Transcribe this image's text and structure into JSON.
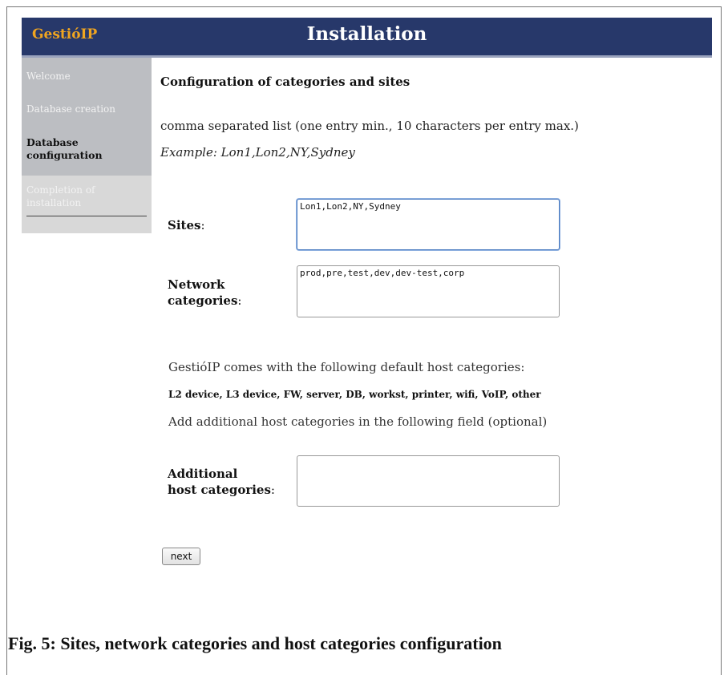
{
  "header": {
    "logo": "GestióIP",
    "title": "Installation"
  },
  "sidebar": {
    "items": [
      {
        "label": "Welcome"
      },
      {
        "label": "Database creation"
      },
      {
        "label_line1": "Database",
        "label_line2": "configuration"
      },
      {
        "label_line1": "Completion of",
        "label_line2": "installation"
      }
    ]
  },
  "main": {
    "section_title": "Configuration of categories and sites",
    "hint": "comma separated list (one entry min., 10 characters per entry max.)",
    "example": "Example: Lon1,Lon2,NY,Sydney",
    "sites": {
      "label": "Sites",
      "suffix": ":",
      "value": "Lon1,Lon2,NY,Sydney"
    },
    "network_categories": {
      "label_line1": "Network",
      "label_line2": "categories",
      "suffix": ":",
      "value": "prod,pre,test,dev,dev-test,corp"
    },
    "default_host_intro": "GestióIP comes with the following default host categories:",
    "default_host_list": "L2 device, L3 device, FW, server, DB, workst, printer, wifi, VoIP, other",
    "additional_hint": "Add additional host categories in the following field (optional)",
    "additional_host": {
      "label_line1": "Additional",
      "label_line2": "host categories",
      "suffix": ":",
      "value": ""
    },
    "next_label": "next"
  },
  "caption": "Fig. 5: Sites, network categories and host categories configuration",
  "colors": {
    "header_bg": "#27386a",
    "logo": "#f0a520",
    "sidebar_active": "#bcbec2",
    "sidebar_rest": "#d8d8d8"
  }
}
